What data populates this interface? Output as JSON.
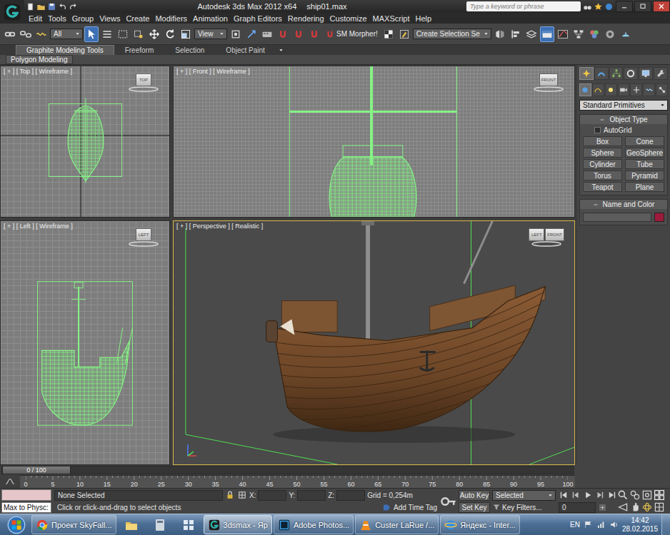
{
  "title_bar": {
    "app": "Autodesk 3ds Max  2012 x64",
    "file": "ship01.max",
    "search_placeholder": "Type a keyword or phrase"
  },
  "menu": [
    "Edit",
    "Tools",
    "Group",
    "Views",
    "Create",
    "Modifiers",
    "Animation",
    "Graph Editors",
    "Rendering",
    "Customize",
    "MAXScript",
    "Help"
  ],
  "toolbar": {
    "items": [
      {
        "kind": "link",
        "selected": false
      },
      {
        "kind": "unlink",
        "selected": false
      },
      {
        "kind": "bind",
        "selected": false
      },
      {
        "kind": "dropdown",
        "label": "All"
      },
      {
        "kind": "select",
        "selected": true
      },
      {
        "kind": "select-by-name",
        "selected": false
      },
      {
        "kind": "rect-region",
        "selected": false
      },
      {
        "kind": "window-crossing",
        "selected": false
      },
      {
        "kind": "move",
        "selected": false
      },
      {
        "kind": "rotate",
        "selected": false
      },
      {
        "kind": "scale",
        "selected": false
      },
      {
        "kind": "dropdown",
        "label": "View"
      },
      {
        "kind": "pivot",
        "selected": false
      },
      {
        "kind": "manipulate",
        "selected": false
      },
      {
        "kind": "keyboard",
        "selected": false
      },
      {
        "kind": "snap",
        "selected": false
      },
      {
        "kind": "angle-snap",
        "selected": false
      },
      {
        "kind": "percent-snap",
        "selected": false
      },
      {
        "kind": "button",
        "label": "SM Morpher!"
      },
      {
        "kind": "checker",
        "selected": false
      },
      {
        "kind": "edit-named",
        "selected": false
      },
      {
        "kind": "dropdown",
        "label": "Create Selection Se"
      },
      {
        "kind": "mirror",
        "selected": false
      },
      {
        "kind": "align",
        "selected": false
      },
      {
        "kind": "layers",
        "selected": false
      },
      {
        "kind": "ribbon",
        "selected": true
      },
      {
        "kind": "curve-editor",
        "selected": false
      },
      {
        "kind": "schematic",
        "selected": false
      },
      {
        "kind": "material",
        "selected": false
      },
      {
        "kind": "render-setup",
        "selected": false
      },
      {
        "kind": "render",
        "selected": false
      }
    ]
  },
  "ribbon": {
    "tabs": [
      {
        "label": "Graphite Modeling Tools",
        "selected": true
      },
      {
        "label": "Freeform",
        "selected": false
      },
      {
        "label": "Selection",
        "selected": false
      },
      {
        "label": "Object Paint",
        "selected": false
      }
    ],
    "panel": "Polygon Modeling"
  },
  "viewports": [
    {
      "label": "[ + ] [ Top ] [ Wireframe ]",
      "view": "top",
      "kind": "wireframe",
      "active": false,
      "cube": [
        "TOP"
      ]
    },
    {
      "label": "[ + ] [ Front ] [ Wireframe ]",
      "view": "front",
      "kind": "wireframe",
      "active": false,
      "cube": [
        "FRONT"
      ]
    },
    {
      "label": "[ + ] [ Left ] [ Wireframe ]",
      "view": "left",
      "kind": "wireframe",
      "active": false,
      "cube": [
        "LEFT"
      ]
    },
    {
      "label": "[ + ] [ Perspective ] [ Realistic ]",
      "view": "perspective",
      "kind": "realistic",
      "active": true,
      "cube": [
        "LEFT",
        "FRONT"
      ]
    }
  ],
  "command_panel": {
    "tabs": [
      {
        "kind": "create",
        "selected": true
      },
      {
        "kind": "modify",
        "selected": false
      },
      {
        "kind": "hierarchy",
        "selected": false
      },
      {
        "kind": "motion",
        "selected": false
      },
      {
        "kind": "display",
        "selected": false
      },
      {
        "kind": "utilities",
        "selected": false
      }
    ],
    "sub_tabs": [
      {
        "kind": "geometry",
        "selected": true
      },
      {
        "kind": "shapes",
        "selected": false
      },
      {
        "kind": "lights",
        "selected": false
      },
      {
        "kind": "cameras",
        "selected": false
      },
      {
        "kind": "helpers",
        "selected": false
      },
      {
        "kind": "spacewarps",
        "selected": false
      },
      {
        "kind": "systems",
        "selected": false
      }
    ],
    "category": "Standard Primitives",
    "object_type": {
      "title": "Object Type",
      "autogrid": {
        "label": "AutoGrid",
        "checked": false
      },
      "buttons": [
        "Box",
        "Cone",
        "Sphere",
        "GeoSphere",
        "Cylinder",
        "Tube",
        "Torus",
        "Pyramid",
        "Teapot",
        "Plane"
      ]
    },
    "name_and_color": {
      "title": "Name and Color",
      "color": "#9e1a3c"
    }
  },
  "timeline": {
    "position": "0 / 100",
    "level": 0,
    "ticks": [
      "0",
      "5",
      "10",
      "15",
      "20",
      "25",
      "30",
      "35",
      "40",
      "45",
      "50",
      "55",
      "60",
      "65",
      "70",
      "75",
      "80",
      "85",
      "90",
      "95",
      "100"
    ]
  },
  "status": {
    "listener": "Max to Physc:",
    "selection": "None Selected",
    "x_label": "X:",
    "y_label": "Y:",
    "z_label": "Z:",
    "grid": "Grid = 0,254m",
    "prompt": "Click or click-and-drag to select objects",
    "add_time_tag": "Add Time Tag",
    "auto_key": "Auto Key",
    "set_key": "Set Key",
    "key_mode": "Selected",
    "key_filters": "Key Filters...",
    "frame": "0"
  },
  "taskbar": {
    "items": [
      {
        "label": "Проект SkyFall...",
        "kind": "chrome",
        "selected": false
      },
      {
        "label": "3dsmax - Яр",
        "kind": "max",
        "selected": true
      },
      {
        "label": "Adobe Photos...",
        "kind": "photoshop",
        "selected": false
      },
      {
        "label": "Custer LaRue /...",
        "kind": "vlc",
        "selected": false
      },
      {
        "label": "Яндекс - Inter...",
        "kind": "ie",
        "selected": false
      }
    ],
    "language": "EN",
    "time": "14:42",
    "date": "28.02.2015"
  }
}
